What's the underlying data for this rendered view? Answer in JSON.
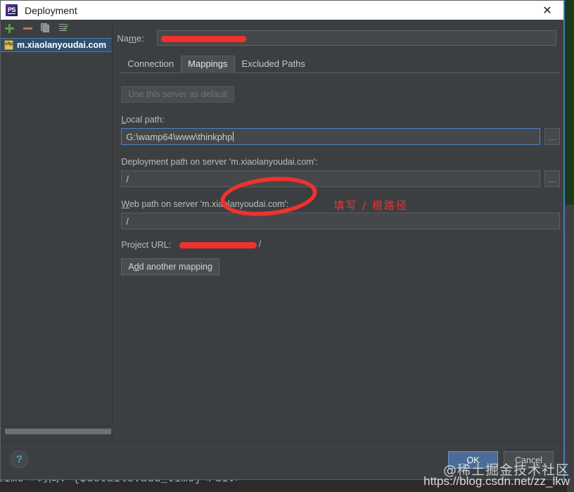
{
  "window": {
    "title": "Deployment",
    "app_icon": "phpstorm-icon",
    "close_icon": "close-icon"
  },
  "left_panel": {
    "toolbar": [
      {
        "name": "add-server-button",
        "icon": "plus-icon",
        "color": "#5a9b4e"
      },
      {
        "name": "remove-server-button",
        "icon": "minus-icon",
        "color": "#c56b60"
      },
      {
        "name": "copy-server-button",
        "icon": "copy-icon"
      },
      {
        "name": "set-default-server-button",
        "icon": "checkmark-list-icon"
      }
    ],
    "servers": [
      {
        "label": "m.xiaolanyoudai.com",
        "icon": "sftp-file-icon",
        "selected": true
      }
    ]
  },
  "form": {
    "name_label": "Name:",
    "name_value": "",
    "name_redacted": true,
    "tabs": [
      {
        "label": "Connection",
        "active": false
      },
      {
        "label": "Mappings",
        "active": true
      },
      {
        "label": "Excluded Paths",
        "active": false
      }
    ],
    "use_default_button": "Use this server as default",
    "use_default_disabled": true,
    "local_path_label": "Local path:",
    "local_path_value": "G:\\wamp64\\www\\thinkphp",
    "deployment_path_label": "Deployment path on server 'm.xiaolanyoudai.com':",
    "deployment_path_value": "/",
    "web_path_label": "Web path on server 'm.xiaolanyoudai.com':",
    "web_path_value": "/",
    "project_url_label": "Project URL:",
    "project_url_value": "",
    "project_url_suffix": "/",
    "project_url_redacted": true,
    "add_mapping_button": "Add another mapping",
    "browse_button_label": "..."
  },
  "annotations": {
    "ellipse_target": "deployment-path-field",
    "note_text": "填写 / 根路径",
    "note_color": "#f0312e"
  },
  "footer": {
    "help_label": "?",
    "ok_label": "OK",
    "cancel_label": "Cancel"
  },
  "watermark": {
    "community": "@稀土掘金技术社区",
    "url": "https://blog.csdn.net/zz_lkw"
  },
  "background": {
    "editor_code": "time'>时间: {$details.add_time}</div>"
  }
}
